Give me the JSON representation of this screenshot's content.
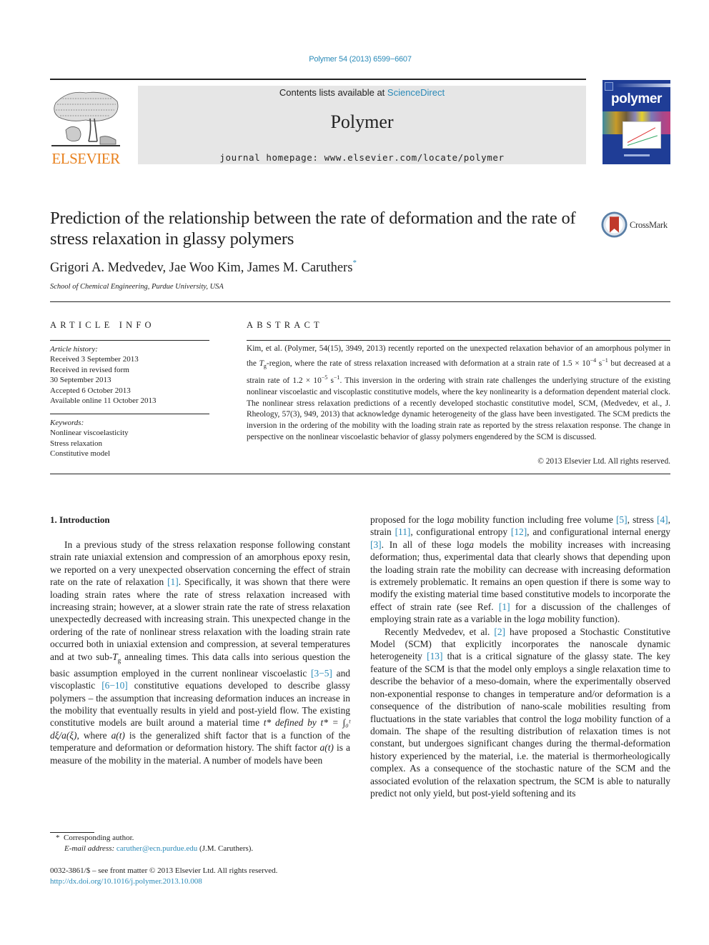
{
  "header": {
    "citation": "Polymer 54 (2013) 6599−6607",
    "contents_prefix": "Contents lists available at ",
    "contents_link": "ScienceDirect",
    "journal_name": "Polymer",
    "homepage": "journal homepage: www.elsevier.com/locate/polymer",
    "publisher_logo_text": "ELSEVIER",
    "cover_title": "polymer",
    "brand_orange": "#e8811e",
    "cover_blue": "#1f3d96",
    "link_color": "#2a8ab8"
  },
  "article": {
    "title": "Prediction of the relationship between the rate of deformation and the rate of stress relaxation in glassy polymers",
    "crossmark_label": "CrossMark",
    "authors": "Grigori A. Medvedev, Jae Woo Kim, James M. Caruthers",
    "author_mark": "*",
    "affiliation": "School of Chemical Engineering, Purdue University, USA"
  },
  "article_info": {
    "heading": "ARTICLE INFO",
    "history_label": "Article history:",
    "history": [
      "Received 3 September 2013",
      "Received in revised form",
      "30 September 2013",
      "Accepted 6 October 2013",
      "Available online 11 October 2013"
    ],
    "keywords_label": "Keywords:",
    "keywords": [
      "Nonlinear viscoelasticity",
      "Stress relaxation",
      "Constitutive model"
    ]
  },
  "abstract": {
    "heading": "ABSTRACT",
    "p1": "Kim, et al. (Polymer, 54(15), 3949, 2013) recently reported on the unexpected relaxation behavior of an amorphous polymer in the ",
    "tg_T": "T",
    "tg_sub": "g",
    "p2": "-region, where the rate of stress relaxation increased with deformation at a strain rate of 1.5 × 10",
    "exp1": "−4",
    "unit1": " s",
    "unit1_exp": "−1",
    "p3": " but decreased at a strain rate of 1.2 × 10",
    "exp2": "−5",
    "unit2": " s",
    "unit2_exp": "−1",
    "p4": ". This inversion in the ordering with strain rate challenges the underlying structure of the existing nonlinear viscoelastic and viscoplastic constitutive models, where the key nonlinearity is a deformation dependent material clock. The nonlinear stress relaxation predictions of a recently developed stochastic constitutive model, SCM, (Medvedev, et al., J. Rheology, 57(3), 949, 2013) that acknowledge dynamic heterogeneity of the glass have been investigated. The SCM predicts the inversion in the ordering of the mobility with the loading strain rate as reported by the stress relaxation response. The change in perspective on the nonlinear viscoelastic behavior of glassy polymers engendered by the SCM is discussed.",
    "copyright": "© 2013 Elsevier Ltd. All rights reserved."
  },
  "intro": {
    "heading": "1.  Introduction",
    "left": {
      "s1": "In a previous study of the stress relaxation response following constant strain rate uniaxial extension and compression of an amorphous epoxy resin, we reported on a very unexpected observation concerning the effect of strain rate on the rate of relaxation ",
      "r1": "[1]",
      "s2": ". Specifically, it was shown that there were loading strain rates where the rate of stress relaxation increased with increasing strain; however, at a slower strain rate the rate of stress relaxation unexpectedly decreased with increasing strain. This unexpected change in the ordering of the rate of nonlinear stress relaxation with the loading strain rate occurred both in uniaxial extension and compression, at several temperatures and at two sub-",
      "tg_T": "T",
      "tg_sub": "g",
      "s3": " annealing times. This data calls into serious question the basic assumption employed in the current nonlinear viscoelastic ",
      "r2": "[3−5]",
      "s4": " and viscoplastic ",
      "r3": "[6−10]",
      "s5": " constitutive equations developed to describe glassy polymers – the assumption that increasing deformation induces an increase in the mobility that eventually results in yield and post-yield flow. The existing constitutive models are built around a material time ",
      "math1": "t* defined by t* = ∫₀ᵗ dξ/a(ξ)",
      "s6": ", where ",
      "math2": "a(t)",
      "s7": " is the generalized shift factor that is a function of the temperature and deformation or deformation history. The shift factor ",
      "math3": "a(t)",
      "s8": " is a measure of the mobility in the material. A number of models have been"
    },
    "right": {
      "s1": "proposed for the log",
      "a": "a",
      "s2": " mobility function including free volume ",
      "r5": "[5]",
      "s3": ", stress ",
      "r4": "[4]",
      "s4": ", strain ",
      "r11": "[11]",
      "s5": ", configurational entropy ",
      "r12": "[12]",
      "s6": ", and configurational internal energy ",
      "r3": "[3]",
      "s7": ". In all of these log",
      "s8": " models the mobility increases with increasing deformation; thus, experimental data that clearly shows that depending upon the loading strain rate the mobility can decrease with increasing deformation is extremely problematic. It remains an open question if there is some way to modify the existing material time based constitutive models to incorporate the effect of strain rate (see Ref. ",
      "r1": "[1]",
      "s9": " for a discussion of the challenges of employing strain rate as a variable in the log",
      "s10": " mobility function).",
      "p2_s1": "Recently Medvedev, et al. ",
      "r2": "[2]",
      "p2_s2": " have proposed a Stochastic Constitutive Model (SCM) that explicitly incorporates the nanoscale dynamic heterogeneity ",
      "r13": "[13]",
      "p2_s3": " that is a critical signature of the glassy state. The key feature of the SCM is that the model only employs a single relaxation time to describe the behavior of a meso-domain, where the experimentally observed non-exponential response to changes in temperature and/or deformation is a consequence of the distribution of nano-scale mobilities resulting from fluctuations in the state variables that control the log",
      "p2_s4": " mobility function of a domain. The shape of the resulting distribution of relaxation times is not constant, but undergoes significant changes during the thermal-deformation history experienced by the material, i.e. the material is thermorheologically complex. As a consequence of the stochastic nature of the SCM and the associated evolution of the relaxation spectrum, the SCM is able to naturally predict not only yield, but post-yield softening and its"
    }
  },
  "footnote": {
    "mark": "*",
    "text": "Corresponding author.",
    "email_label": "E-mail address:",
    "email": "caruther@ecn.purdue.edu",
    "email_suffix": " (J.M. Caruthers)."
  },
  "issn": {
    "line": "0032-3861/$ – see front matter © 2013 Elsevier Ltd. All rights reserved.",
    "doi": "http://dx.doi.org/10.1016/j.polymer.2013.10.008"
  }
}
